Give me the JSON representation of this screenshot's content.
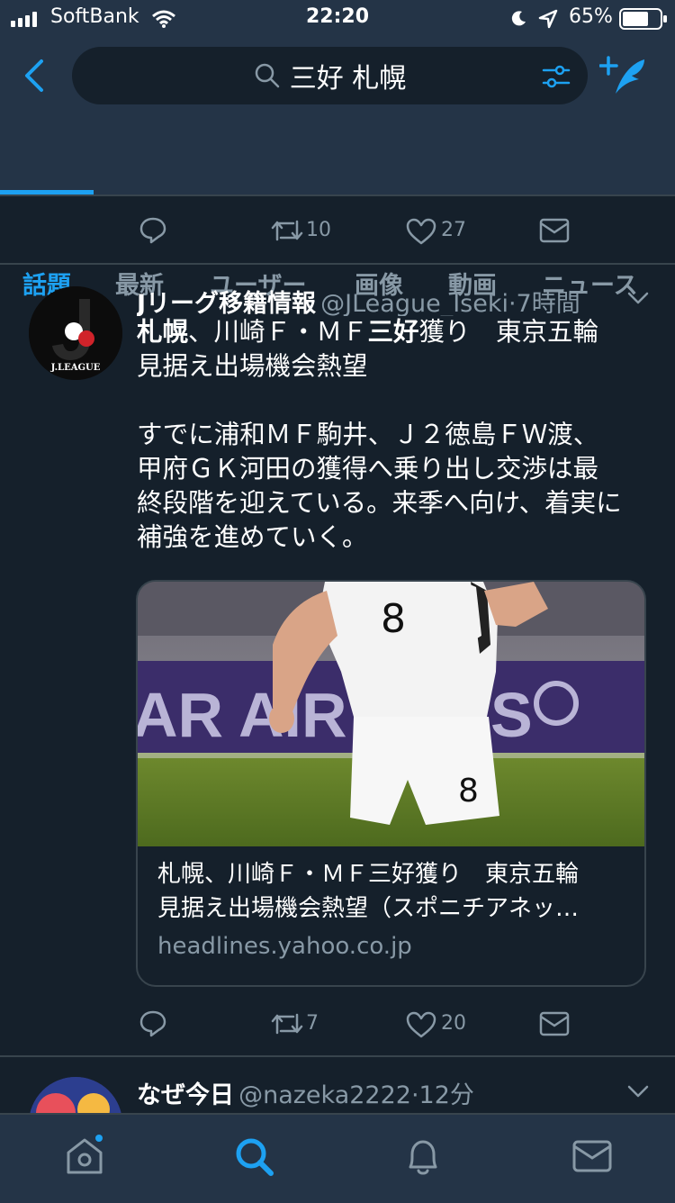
{
  "status_bar": {
    "carrier": "SoftBank",
    "time": "22:20",
    "battery": "65%"
  },
  "search": {
    "query": "三好 札幌"
  },
  "tabs": [
    {
      "label": "話題",
      "active": true
    },
    {
      "label": "最新",
      "active": false
    },
    {
      "label": "ユーザー",
      "active": false
    },
    {
      "label": "画像",
      "active": false
    },
    {
      "label": "動画",
      "active": false
    },
    {
      "label": "ニュース",
      "active": false
    }
  ],
  "prev_tweet_actions": {
    "retweets": "10",
    "likes": "27"
  },
  "tweet": {
    "name": "Jリーグ移籍情報",
    "handle": "@JLeague_Iseki",
    "time": "·7時間",
    "headline_bold1": "札幌",
    "headline_a": "、川崎Ｆ・ＭＦ",
    "headline_bold2": "三好",
    "headline_b": "獲り　東京五輪",
    "headline_line2": "見据え出場機会熱望",
    "body_line1": "すでに浦和ＭＦ駒井、Ｊ２徳島ＦＷ渡、",
    "body_line2": "甲府ＧＫ河田の獲得へ乗り出し交渉は最",
    "body_line3": "終段階を迎えている。来季へ向け、着実に",
    "body_line4": "補強を進めていく。",
    "avatar_label": "J.LEAGUE",
    "card": {
      "image_text": "AR AIR",
      "image_text2": "S",
      "jersey_number": "8",
      "title_line1": "札幌、川崎Ｆ・ＭＦ三好獲り　東京五輪",
      "title_line2": "見据え出場機会熱望（スポニチアネッ…",
      "domain": "headlines.yahoo.co.jp"
    },
    "retweets": "7",
    "likes": "20"
  },
  "next_tweet": {
    "name": "なぜ今日",
    "handle": "@nazeka2222",
    "time": "·12分"
  },
  "colors": {
    "background": "#15202b",
    "header": "#243447",
    "accent": "#1da1f2",
    "muted": "#8899a6",
    "divider": "#38444d"
  },
  "icons": [
    "wifi-icon",
    "moon-icon",
    "location-icon",
    "battery-icon",
    "back-icon",
    "search-icon",
    "filter-icon",
    "compose-icon",
    "reply-icon",
    "retweet-icon",
    "like-icon",
    "dm-icon",
    "chevron-down-icon",
    "home-icon",
    "explore-icon",
    "bell-icon",
    "mail-icon"
  ]
}
